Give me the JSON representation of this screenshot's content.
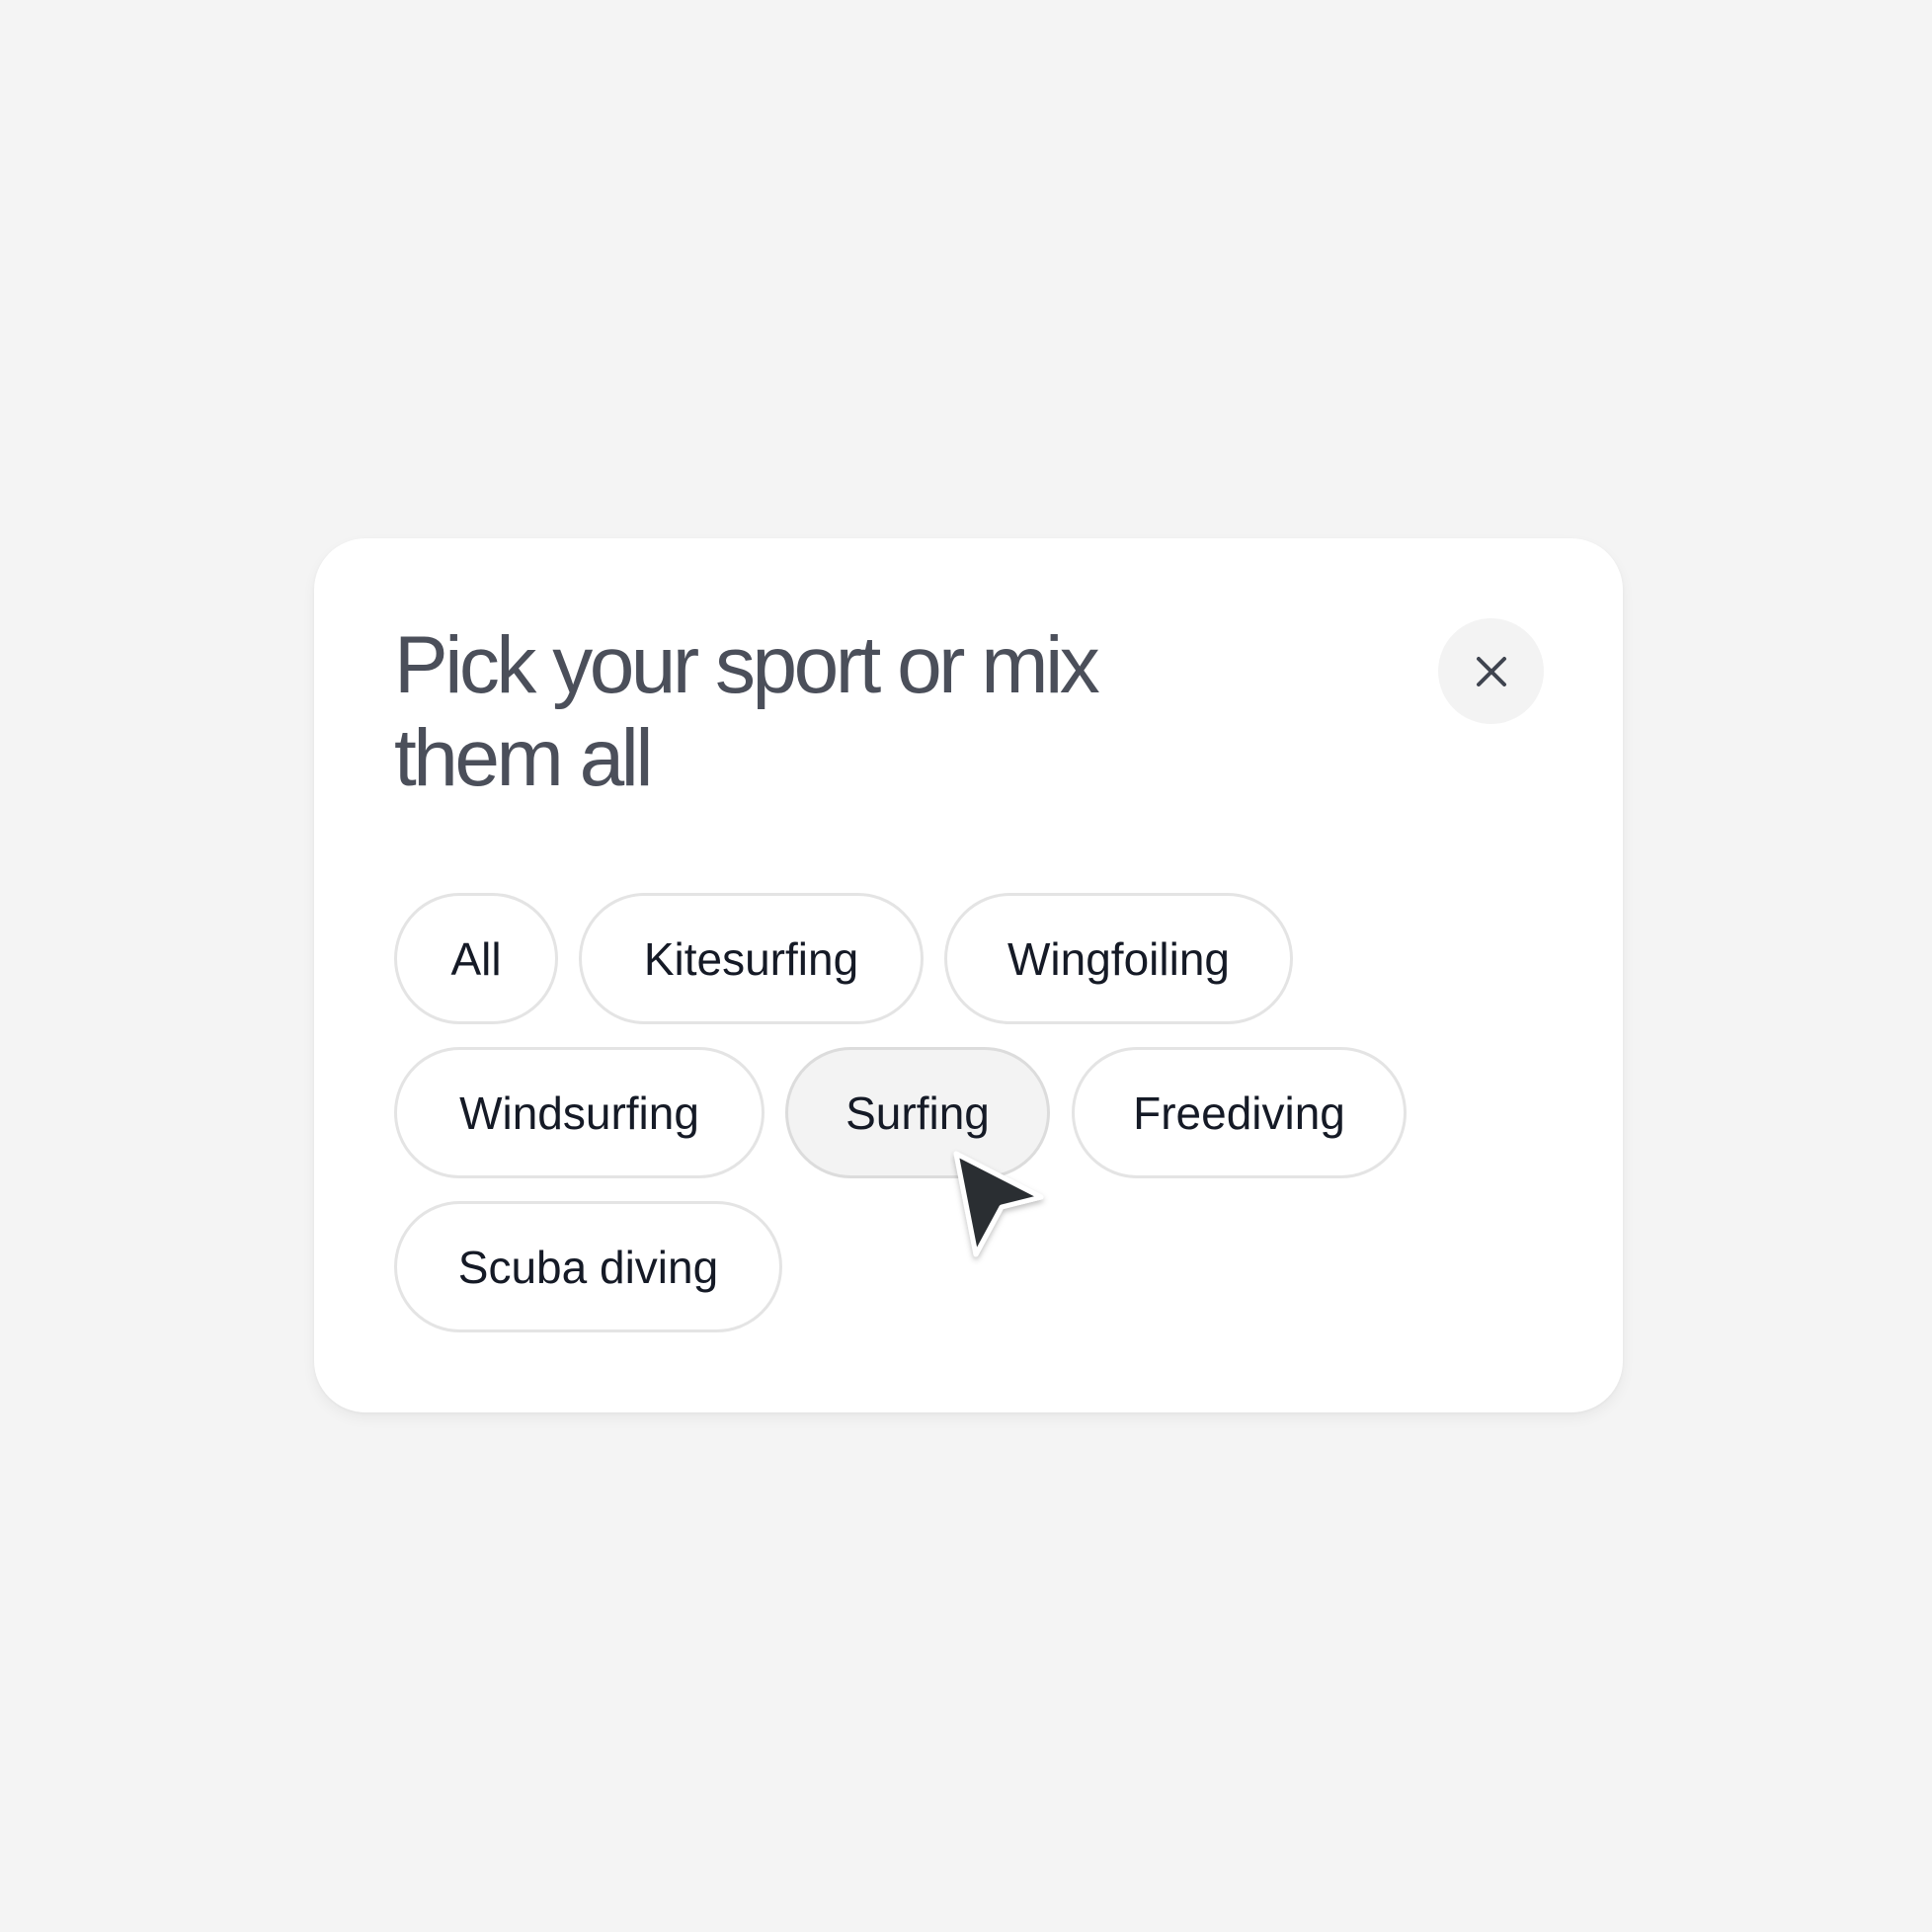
{
  "dialog": {
    "title": "Pick your sport or mix them all",
    "close_icon": "close-icon"
  },
  "chips": [
    {
      "label": "All",
      "selected": false
    },
    {
      "label": "Kitesurfing",
      "selected": false
    },
    {
      "label": "Wingfoiling",
      "selected": false
    },
    {
      "label": "Windsurfing",
      "selected": false
    },
    {
      "label": "Surfing",
      "selected": false,
      "hovered": true
    },
    {
      "label": "Freediving",
      "selected": false
    },
    {
      "label": "Scuba diving",
      "selected": false
    }
  ],
  "cursor": {
    "icon": "pointer-cursor-icon"
  },
  "colors": {
    "background": "#f4f4f4",
    "card": "#ffffff",
    "title_text": "#4b4f5a",
    "chip_text": "#151a26",
    "chip_border": "#e4e4e4",
    "chip_hover_bg": "#f3f3f3",
    "close_button_bg": "#f3f3f3"
  }
}
